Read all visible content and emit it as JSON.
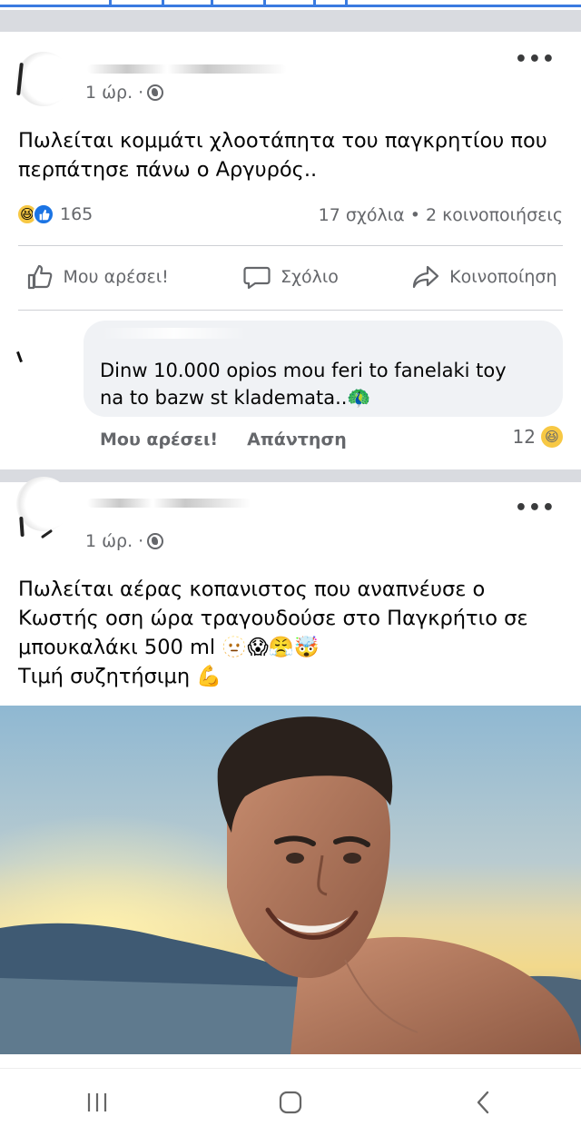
{
  "posts": [
    {
      "time": "1 ώρ. ·",
      "more": "•••",
      "text": "Πωλείται κομμάτι χλοοτάπητα του παγκρητίου που\nπερπάτησε πάνω ο Αργυρός..",
      "reaction_count": "165",
      "stats": "17 σχόλια • 2 κοινοποιήσεις",
      "actions": {
        "like": "Μου αρέσει!",
        "comment": "Σχόλιο",
        "share": "Κοινοποίηση"
      },
      "comment": {
        "text": "Dinw 10.000 opios mou feri to fanelaki toy\nna to bazw st klademata..🦚",
        "like": "Μου αρέσει!",
        "reply": "Απάντηση",
        "reaction_count": "12"
      }
    },
    {
      "time": "1 ώρ. ·",
      "more": "•••",
      "text": "Πωλείται αέρας κοπανιστος  που αναπνέυσε ο\nΚωστής οση ώρα τραγουδούσε στο Παγκρήτιο σε\nμπουκαλάκι 500 ml 🫥😱😤🤯\nΤιμή συζητήσιμη 💪"
    }
  ],
  "colors": {
    "accent": "#1b74e4",
    "secondary_text": "#65676b",
    "separator": "#d9dbe0",
    "bubble": "#f0f2f5"
  },
  "icons": {
    "globe": "globe-icon",
    "like": "thumbs-up-icon",
    "comment": "comment-bubble-icon",
    "share": "share-arrow-icon",
    "recents": "recent-apps-icon",
    "home": "home-icon",
    "back": "back-icon"
  }
}
